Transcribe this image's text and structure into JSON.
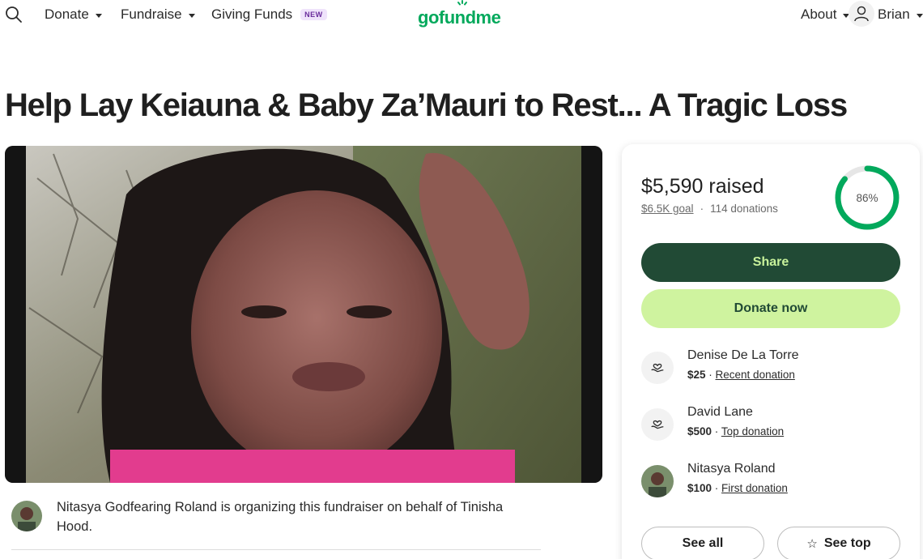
{
  "nav": {
    "donate_label": "Donate",
    "fundraise_label": "Fundraise",
    "giving_funds_label": "Giving Funds",
    "new_badge": "NEW",
    "logo_text": "gofundme",
    "about_label": "About",
    "user_name": "Brian"
  },
  "campaign": {
    "title": "Help Lay Keiauna & Baby Za’Mauri to Rest... A Tragic Loss",
    "organizer_text": "Nitasya Godfearing Roland is organizing this fundraiser on behalf of Tinisha Hood."
  },
  "stats": {
    "raised": "$5,590 raised",
    "goal": "$6.5K goal",
    "separator": "·",
    "donations": "114 donations",
    "progress_label": "86%",
    "progress_fraction": 0.86
  },
  "actions": {
    "share_label": "Share",
    "donate_label": "Donate now",
    "see_all_label": "See all",
    "see_top_label": "See top"
  },
  "donors": [
    {
      "name": "Denise De La Torre",
      "amount": "$25",
      "sep": " · ",
      "type": "Recent donation",
      "icon": "heart-hand-icon"
    },
    {
      "name": "David Lane",
      "amount": "$500",
      "sep": " · ",
      "type": "Top donation",
      "icon": "heart-hand-icon"
    },
    {
      "name": "Nitasya Roland",
      "amount": "$100",
      "sep": " · ",
      "type": "First donation",
      "icon": "avatar"
    }
  ],
  "colors": {
    "brand_green": "#02a95c",
    "share_bg": "#214a35",
    "donate_bg": "#cff39f",
    "ring_green": "#02a95c"
  }
}
